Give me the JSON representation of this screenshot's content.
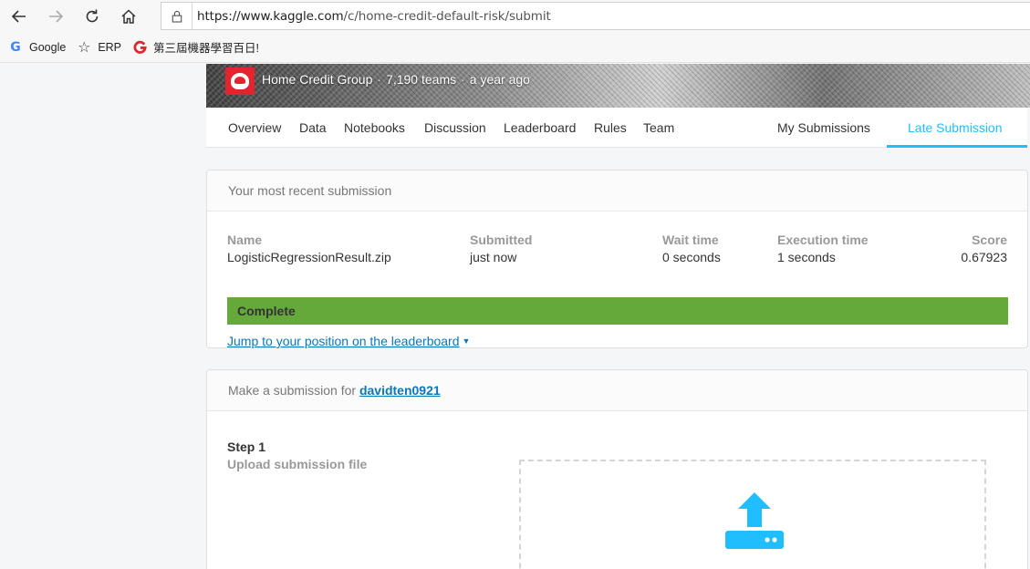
{
  "browser": {
    "url_prefix": "https://www.kaggle.com",
    "url_path": "/c/home-credit-default-risk/submit",
    "bookmarks": [
      {
        "icon": "google-icon",
        "label": "Google"
      },
      {
        "icon": "star-icon",
        "label": "ERP"
      },
      {
        "icon": "red-logo-icon",
        "label": "第三屆機器學習百日!"
      }
    ]
  },
  "competition": {
    "host": "Home Credit Group",
    "teams": "7,190 teams",
    "age": "a year ago"
  },
  "tabs": {
    "overview": "Overview",
    "data": "Data",
    "notebooks": "Notebooks",
    "discussion": "Discussion",
    "leaderboard": "Leaderboard",
    "rules": "Rules",
    "team": "Team",
    "my_submissions": "My Submissions",
    "late_submission": "Late Submission"
  },
  "recent": {
    "heading": "Your most recent submission",
    "name_label": "Name",
    "name_value": "LogisticRegressionResult.zip",
    "submitted_label": "Submitted",
    "submitted_value": "just now",
    "wait_label": "Wait time",
    "wait_value": "0 seconds",
    "exec_label": "Execution time",
    "exec_value": "1 seconds",
    "score_label": "Score",
    "score_value": "0.67923",
    "status": "Complete",
    "status_color": "#64a93a",
    "jump_link": "Jump to your position on the leaderboard"
  },
  "make_submission": {
    "heading_prefix": "Make a submission for",
    "username": "davidten0921",
    "step_title": "Step 1",
    "step_subtitle": "Upload submission file",
    "accent_color": "#20beff"
  }
}
